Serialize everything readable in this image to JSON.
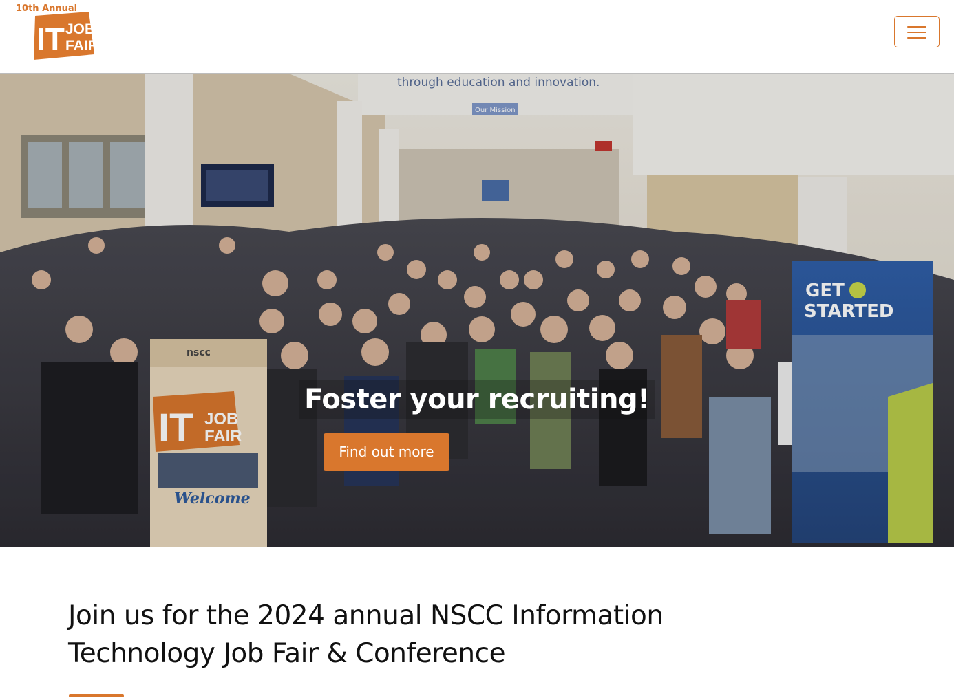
{
  "header": {
    "logo": {
      "annual_text": "10th Annual",
      "wordmark_it": "IT",
      "wordmark_job": "JOB",
      "wordmark_fair": "FAIR"
    },
    "menu_toggle_icon": "hamburger-icon"
  },
  "hero": {
    "headline": "Foster your recruiting!",
    "cta_label": "Find out more",
    "photo": {
      "wall_text": "through education and innovation.",
      "mission_sign": "Our Mission",
      "banner_left_org": "nscc",
      "banner_left_title_it": "IT",
      "banner_left_title_job": "JOB",
      "banner_left_title_fair": "FAIR",
      "banner_left_footer": "Welcome",
      "banner_right_line1": "GET",
      "banner_right_line2": "STARTED"
    }
  },
  "intro": {
    "heading": "Join us for the 2024 annual NSCC Information Technology Job Fair & Conference"
  },
  "colors": {
    "brand_orange": "#d9772d",
    "text_dark": "#111111",
    "header_border": "#bdbdbd"
  }
}
